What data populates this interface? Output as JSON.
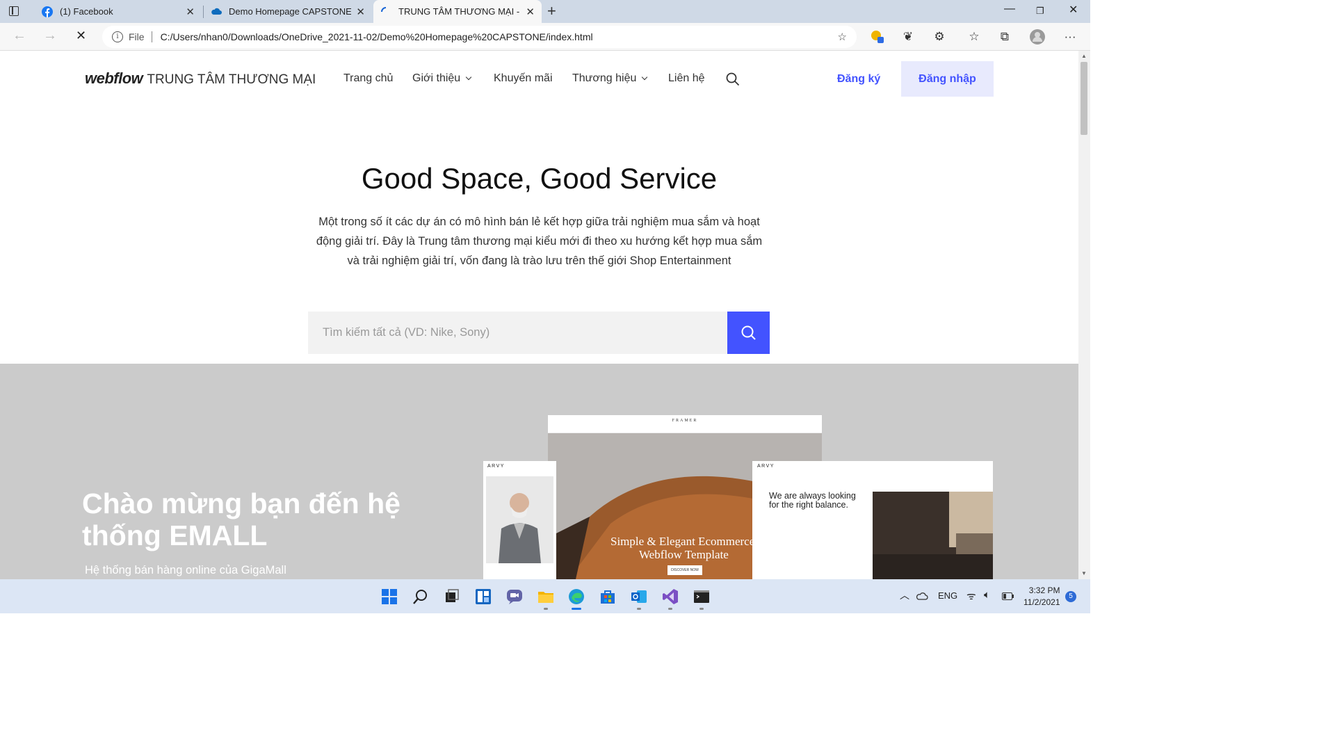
{
  "browser": {
    "tabs": [
      {
        "label": "(1) Facebook",
        "active": false
      },
      {
        "label": "Demo Homepage CAPSTONE - O",
        "active": false
      },
      {
        "label": "TRUNG TÂM THƯƠNG MẠI - E-M",
        "active": true
      }
    ],
    "address": {
      "scheme_label": "File",
      "url": "C:/Users/nhan0/Downloads/OneDrive_2021-11-02/Demo%20Homepage%20CAPSTONE/index.html"
    }
  },
  "site": {
    "brand": {
      "logo": "webflow",
      "name": "TRUNG TÂM THƯƠNG MẠI"
    },
    "nav": {
      "home": "Trang chủ",
      "about": "Giới thiệu",
      "promo": "Khuyến mãi",
      "brands": "Thương hiệu",
      "contact": "Liên hệ"
    },
    "signup": "Đăng ký",
    "login": "Đăng nhập",
    "accent_color": "#4353ff"
  },
  "hero": {
    "title": "Good Space, Good Service",
    "description": "Một trong số ít các dự án có mô hình bán lẻ kết hợp giữa trải nghiệm mua sắm và hoạt động giải trí. Đây là Trung tâm thương mại kiểu mới đi theo xu hướng kết hợp mua sắm và trải nghiệm giải trí, vốn đang là trào lưu trên thế giới Shop Entertainment",
    "search_placeholder": "Tìm kiếm tất cả (VD: Nike, Sony)"
  },
  "welcome": {
    "title": "Chào mừng bạn đến hệ thống EMALL",
    "subtitle": "Hệ thống bán hàng online của GigaMall"
  },
  "mockups": {
    "left_brand": "ARVY",
    "center_brand": "FRAMER",
    "center_headline_1": "Simple & Elegant Ecommerce",
    "center_headline_2": "Webflow Template",
    "center_cta": "DISCOVER NOW",
    "right_brand": "ARVY",
    "right_text": "We are always looking for the right balance."
  },
  "taskbar": {
    "language": "ENG",
    "time": "3:32 PM",
    "date": "11/2/2021",
    "notifications": "5"
  }
}
